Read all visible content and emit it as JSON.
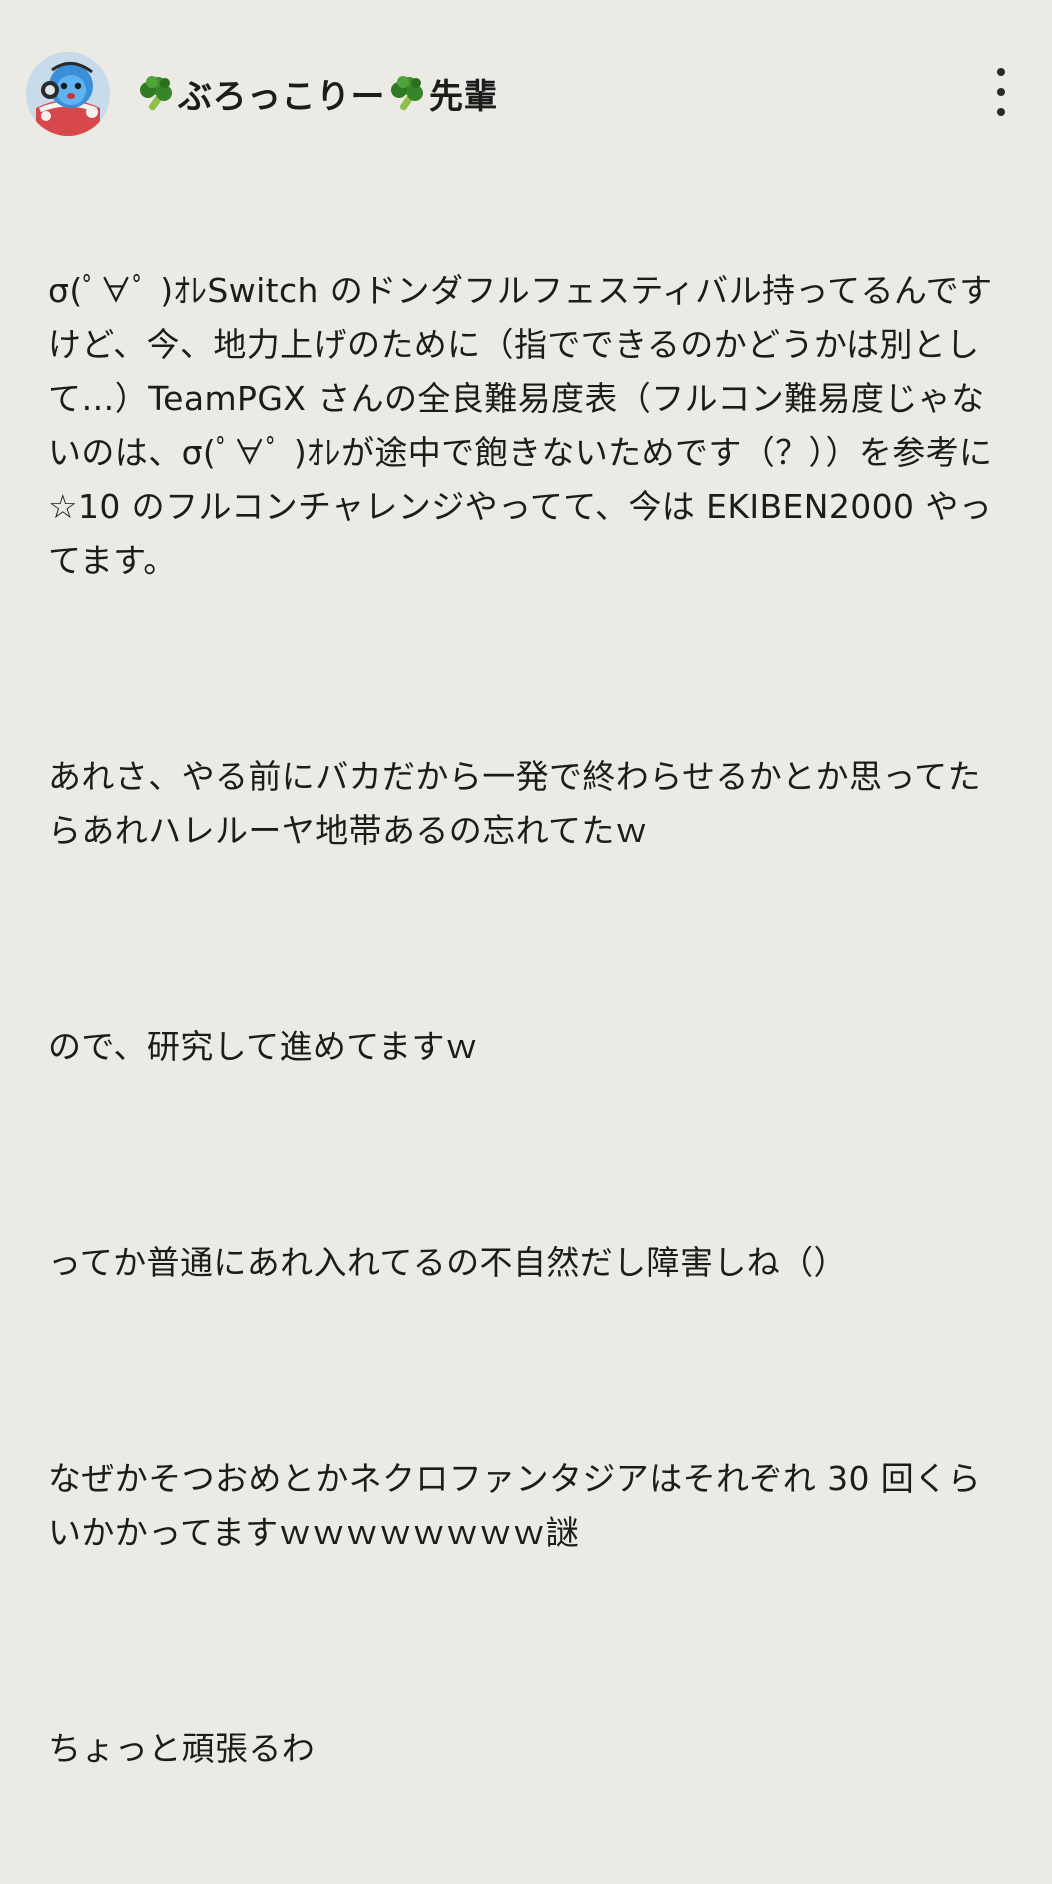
{
  "header": {
    "username": "ぶろっこりー",
    "suffix": "先輩",
    "prefix_icon": "broccoli-icon",
    "mid_icon": "broccoli-icon",
    "avatar_icon": "blue-drum-mascot-avatar",
    "more_icon": "vertical-ellipsis-icon"
  },
  "post": {
    "paragraphs": [
      "σ(ﾟ∀ﾟ )ｵﾚSwitch のドンダフルフェスティバル持ってるんですけど、今、地力上げのために（指でできるのかどうかは別として…）TeamPGX さんの全良難易度表（フルコン難易度じゃないのは、σ(ﾟ∀ﾟ )ｵﾚが途中で飽きないためです（？））を参考に☆10 のフルコンチャレンジやってて、今は EKIBEN2000 やってます。",
      "あれさ、やる前にバカだから一発で終わらせるかとか思ってたらあれハレルーヤ地帯あるの忘れてたｗ",
      "ので、研究して進めてますｗ",
      "ってか普通にあれ入れてるの不自然だし障害しね（）",
      "なぜかそつおめとかネクロファンタジアはそれぞれ 30 回くらいかかってますｗｗｗｗｗｗｗｗ謎",
      "ちょっと頑張るわ"
    ]
  }
}
